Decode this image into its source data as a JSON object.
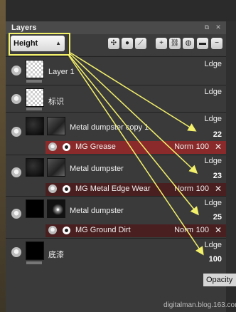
{
  "panel": {
    "title": "Layers"
  },
  "toolbar": {
    "blend_select": "Height",
    "buttons": [
      "mask-tool-icon",
      "circle-icon",
      "brush-icon",
      "add-icon",
      "link-icon",
      "globe-icon",
      "folder-icon",
      "minus-icon"
    ]
  },
  "layers": [
    {
      "name": "Layer 1",
      "mode": "Ldge",
      "value": "",
      "thumb": "checker",
      "effect": null
    },
    {
      "name": "标识",
      "mode": "Ldge",
      "value": "",
      "thumb": "checker",
      "effect": null
    },
    {
      "name": "Metal dumpster copy 1",
      "mode": "Ldge",
      "value": "22",
      "thumb": "dark",
      "effect": {
        "name": "MG Grease",
        "mode": "Norm",
        "opacity": "100",
        "active": true
      }
    },
    {
      "name": "Metal dumpster",
      "mode": "Ldge",
      "value": "23",
      "thumb": "mid",
      "effect": {
        "name": "MG Metal Edge Wear",
        "mode": "Norm",
        "opacity": "100",
        "active": false
      }
    },
    {
      "name": "Metal dumpster",
      "mode": "Ldge",
      "value": "25",
      "thumb": "white-speck",
      "effect": {
        "name": "MG Ground Dirt",
        "mode": "Norm",
        "opacity": "100",
        "active": false
      }
    },
    {
      "name": "底漆",
      "mode": "Ldge",
      "value": "100",
      "thumb": "black",
      "effect": null
    }
  ],
  "tooltip": "Opacity",
  "watermark": "digitalman.blog.163.com",
  "colors": {
    "annotation": "#f3f06a",
    "effect_active": "#8a2a2a",
    "effect_row": "#4a1f20"
  }
}
